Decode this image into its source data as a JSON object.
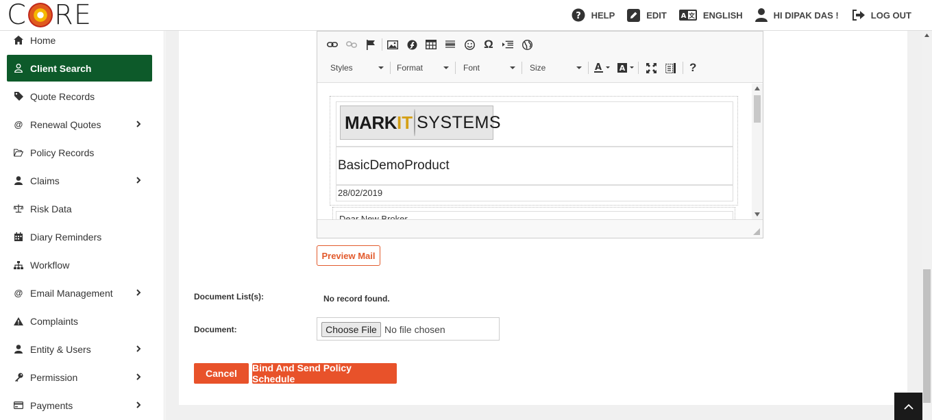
{
  "brand": {
    "logo_letters": [
      "C",
      "R",
      "E"
    ]
  },
  "header_nav": {
    "help": "HELP",
    "edit": "EDIT",
    "language": "ENGLISH",
    "user": "HI DIPAK DAS !",
    "logout": "LOG OUT"
  },
  "sidebar": {
    "items": [
      {
        "label": "Home",
        "icon": "home-icon"
      },
      {
        "label": "Client Search",
        "icon": "user-outline-icon",
        "active": true
      },
      {
        "label": "Quote Records",
        "icon": "tag-icon"
      },
      {
        "label": "Renewal Quotes",
        "icon": "at-icon",
        "expandable": true
      },
      {
        "label": "Policy Records",
        "icon": "folder-open-icon"
      },
      {
        "label": "Claims",
        "icon": "user-icon",
        "expandable": true
      },
      {
        "label": "Risk Data",
        "icon": "scales-icon"
      },
      {
        "label": "Diary Reminders",
        "icon": "calendar-icon"
      },
      {
        "label": "Workflow",
        "icon": "sitemap-icon"
      },
      {
        "label": "Email Management",
        "icon": "at-icon",
        "expandable": true
      },
      {
        "label": "Complaints",
        "icon": "warning-icon"
      },
      {
        "label": "Entity & Users",
        "icon": "user-icon",
        "expandable": true
      },
      {
        "label": "Permission",
        "icon": "key-icon",
        "expandable": true
      },
      {
        "label": "Payments",
        "icon": "credit-card-icon",
        "expandable": true
      }
    ]
  },
  "editor": {
    "combos": {
      "styles": "Styles",
      "format": "Format",
      "font": "Font",
      "size": "Size"
    },
    "content": {
      "brand_part1": "MARK",
      "brand_part2": "IT",
      "brand_part3": "SYSTEMS",
      "product": "BasicDemoProduct",
      "date": "28/02/2019",
      "greeting": "Dear New Broker"
    }
  },
  "actions": {
    "preview_mail": "Preview Mail",
    "cancel": "Cancel",
    "bind_send": "Bind And Send Policy Schedule"
  },
  "form": {
    "document_list_label": "Document List(s):",
    "document_list_value": "No record found.",
    "document_label": "Document:",
    "choose_file": "Choose File",
    "file_status": "No file chosen"
  },
  "colors": {
    "accent": "#e8522a",
    "active_menu": "#0d5a2a"
  }
}
